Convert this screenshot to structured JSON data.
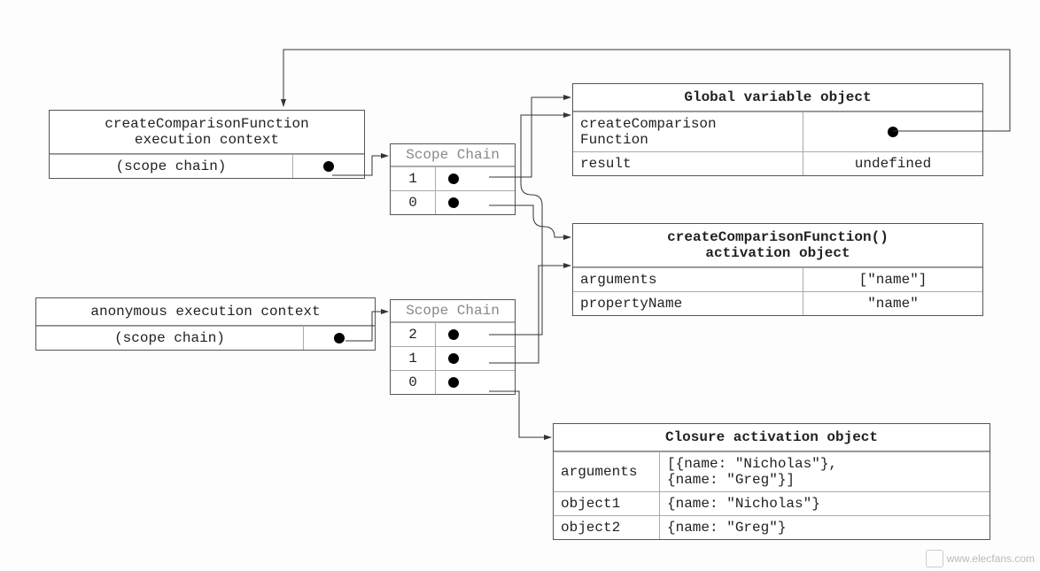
{
  "ctx1": {
    "title_l1": "createComparisonFunction",
    "title_l2": "execution context",
    "scope_label": "(scope chain)"
  },
  "ctx2": {
    "title": "anonymous execution context",
    "scope_label": "(scope chain)"
  },
  "scopechain_label": "Scope Chain",
  "sc1": {
    "r0": "1",
    "r1": "0"
  },
  "sc2": {
    "r0": "2",
    "r1": "1",
    "r2": "0"
  },
  "global": {
    "title": "Global variable object",
    "k0": "createComparison",
    "k0b": "Function",
    "k1": "result",
    "v1": "undefined"
  },
  "activation": {
    "title": "createComparisonFunction()",
    "title2": "activation object",
    "k0": "arguments",
    "v0": "[\"name\"]",
    "k1": "propertyName",
    "v1": "\"name\""
  },
  "closure": {
    "title": "Closure activation object",
    "k0": "arguments",
    "v0a": "[{name: \"Nicholas\"},",
    "v0b": "{name: \"Greg\"}]",
    "k1": "object1",
    "v1": "{name: \"Nicholas\"}",
    "k2": "object2",
    "v2": "{name: \"Greg\"}"
  },
  "watermark": "www.elecfans.com"
}
